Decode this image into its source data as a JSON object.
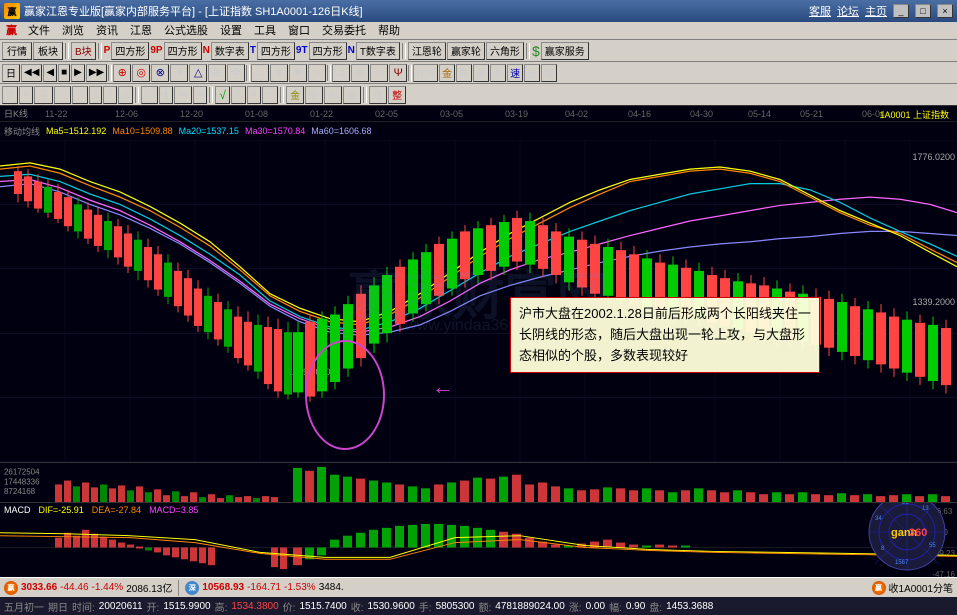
{
  "titlebar": {
    "title": "赢家江恩专业版[赢家内部服务平台] - [上证指数  SH1A0001-126日K线]",
    "links": [
      "客服",
      "论坛",
      "主页"
    ],
    "win_controls": [
      "_",
      "□",
      "×"
    ]
  },
  "menubar": {
    "items": [
      "赢",
      "文件",
      "浏览",
      "资讯",
      "江恩",
      "公式选股",
      "设置",
      "工具",
      "窗口",
      "交易委托",
      "帮助"
    ]
  },
  "toolbar1": {
    "items": [
      "行情",
      "板块",
      "B块",
      "P四方形",
      "9P四方形",
      "N数字表",
      "T四方形",
      "9T四方形",
      "N T数字表",
      "江恩轮",
      "赢家轮",
      "六角形",
      "赢家服务"
    ]
  },
  "chart": {
    "title_left": "日K线",
    "title_right": "1A0001  上证指数",
    "ma_labels": {
      "ma5": "Ma5=1512.192",
      "ma10": "Ma10=1509.88",
      "ma20": "Ma20=1537.15",
      "ma30": "Ma30=1570.84",
      "ma60": "Ma60=1606.68"
    },
    "price_labels": [
      "1776.0200",
      "1339.2000",
      "1339.2000"
    ],
    "annotation": "沪市大盘在2002.1.28日前后形成两个长阳线夹住一长阴线的形态，随后大盘出现一轮上攻，与大盘形态相似的个股，多数表现较好",
    "dates": [
      "11-22",
      "12-06",
      "12-20",
      "01-08",
      "01-22",
      "02-05",
      "03-05",
      "03-19",
      "04-02",
      "04-16",
      "04-30",
      "05-14",
      "05-21",
      "06-04"
    ],
    "watermark": "赢家财富网",
    "watermark_url": "www.yindaa360.com"
  },
  "macd": {
    "title": "MACD",
    "dif": "DIF=-25.91",
    "dea": "DEA=-27.84",
    "macd_val": "MACD=3.85",
    "levels": [
      "36.63",
      "8.70",
      "-19.23",
      "-47.16"
    ]
  },
  "statusbar": {
    "index1_val": "3033.66",
    "index1_chg": "-44.46",
    "index1_pct": "-1.44%",
    "index1_amt": "2086.13亿",
    "index2_val": "10568.93",
    "index2_chg": "-164.71",
    "index2_pct": "-1.53%",
    "index2_extra": "3484.",
    "stock_label": "收1A0001分笔"
  },
  "infobar": {
    "period": "五月初一",
    "day": "期日",
    "time_label": "时间:",
    "time_val": "20020611",
    "open_label": "开:",
    "open_val": "1515.9900",
    "high_label": "高:",
    "high_val": "1534.3800",
    "price_label": "价:",
    "price_val": "1515.7400",
    "close_label": "收:",
    "close_val": "1530.9600",
    "shares_label": "手:",
    "shares_val": "5805300",
    "amount_label": "额:",
    "amount_val": "4781889024.00",
    "change_label": "涨:",
    "change_val": "0.00",
    "pct_label": "幅:",
    "pct_val": "0.90",
    "target_label": "盘:",
    "target_val": "1453.3688"
  }
}
